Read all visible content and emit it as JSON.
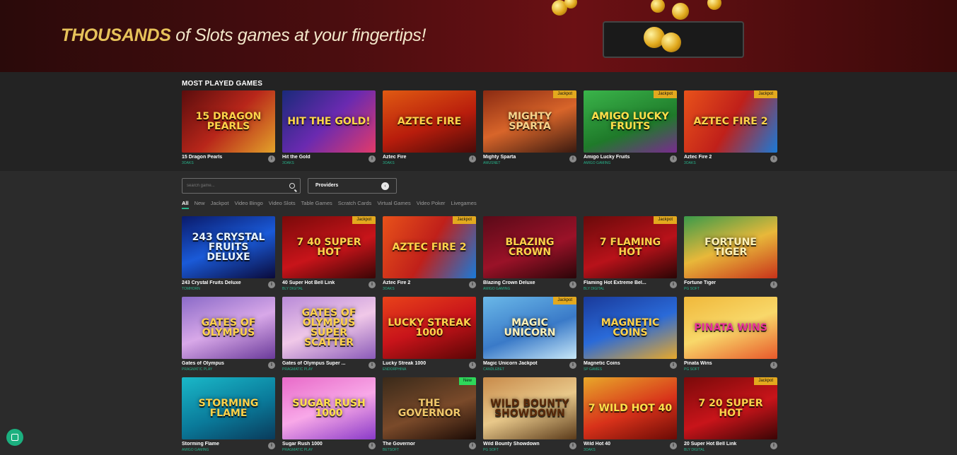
{
  "banner": {
    "highlight": "THOUSANDS",
    "text": " of Slots games at your fingertips!"
  },
  "most_played": {
    "title": "MOST PLAYED GAMES",
    "games": [
      {
        "name": "15 Dragon Pearls",
        "provider": "3OAKS",
        "art": "15 DRAGON PEARLS",
        "bg": "linear-gradient(135deg,#5a0d0d,#b8261a 50%,#e3a32a)",
        "color": "#ffd24a",
        "badge": ""
      },
      {
        "name": "Hit the Gold",
        "provider": "3OAKS",
        "art": "HIT THE GOLD!",
        "bg": "linear-gradient(135deg,#1a2a7a,#6a2ab0 50%,#e23a6a)",
        "color": "#ffd84a",
        "badge": ""
      },
      {
        "name": "Aztec Fire",
        "provider": "3OAKS",
        "art": "AZTEC FIRE",
        "bg": "linear-gradient(160deg,#e05a12,#b81d0c 55%,#4a0a08)",
        "color": "#ffd24a",
        "badge": ""
      },
      {
        "name": "Mighty Sparta",
        "provider": "AMUSNET",
        "art": "MIGHTY SPARTA",
        "bg": "linear-gradient(160deg,#8a2a12,#d8652a 50%,#3a1a10)",
        "color": "#f6d28a",
        "badge": "Jackpot"
      },
      {
        "name": "Amigo Lucky Fruits",
        "provider": "AMIGO GAMING",
        "art": "AMIGO LUCKY FRUITS",
        "bg": "linear-gradient(160deg,#3ab44a,#1f7a2a 60%,#7a2a90)",
        "color": "#ffe04a",
        "badge": "Jackpot"
      },
      {
        "name": "Aztec Fire 2",
        "provider": "3OAKS",
        "art": "AZTEC FIRE 2",
        "bg": "linear-gradient(120deg,#e8521a,#c0201a 50%,#1a7ad8)",
        "color": "#ffd24a",
        "badge": "Jackpot"
      }
    ]
  },
  "search": {
    "placeholder": "search game..."
  },
  "providers": {
    "label": "Providers",
    "toggle": "‹"
  },
  "tabs": [
    "All",
    "New",
    "Jackpot",
    "Video Bingo",
    "Video Slots",
    "Table Games",
    "Scratch Cards",
    "Virtual Games",
    "Video Poker",
    "Livegames"
  ],
  "games": [
    {
      "name": "243 Crystal Fruits Deluxe",
      "provider": "TOMHORN",
      "art": "243 CRYSTAL FRUITS DELUXE",
      "bg": "linear-gradient(160deg,#0a1a6a,#1a5ad8 50%,#0a0a3a)",
      "color": "#e8f4ff",
      "badge": ""
    },
    {
      "name": "40 Super Hot Bell Link",
      "provider": "BLY DIGITAL",
      "art": "7 40 SUPER HOT",
      "bg": "linear-gradient(160deg,#7a0a0a,#c8141a 55%,#3a0505)",
      "color": "#ffd24a",
      "badge": "Jackpot"
    },
    {
      "name": "Aztec Fire 2",
      "provider": "3OAKS",
      "art": "AZTEC FIRE 2",
      "bg": "linear-gradient(120deg,#e8521a,#c0201a 50%,#1a7ad8)",
      "color": "#ffd24a",
      "badge": "Jackpot"
    },
    {
      "name": "Blazing Crown Deluxe",
      "provider": "AMIGO GAMING",
      "art": "BLAZING CROWN",
      "bg": "linear-gradient(160deg,#5a0a18,#9a1228 55%,#2a0508)",
      "color": "#ffd24a",
      "badge": ""
    },
    {
      "name": "Flaming Hot Extreme Bel...",
      "provider": "BLY DIGITAL",
      "art": "7 FLAMING HOT",
      "bg": "linear-gradient(160deg,#6a0a0a,#b8121a 55%,#2a0505)",
      "color": "#ffd24a",
      "badge": "Jackpot"
    },
    {
      "name": "Fortune Tiger",
      "provider": "PG SOFT",
      "art": "FORTUNE TIGER",
      "bg": "linear-gradient(160deg,#3a9a4a,#e8b83a 50%,#c8321a)",
      "color": "#fff2b8",
      "badge": ""
    },
    {
      "name": "Gates of Olympus",
      "provider": "PRAGMATIC PLAY",
      "art": "GATES OF OLYMPUS",
      "bg": "linear-gradient(160deg,#8a6ac8,#d8a8e8 50%,#6a3a9a)",
      "color": "#ffd24a",
      "badge": ""
    },
    {
      "name": "Gates of Olympus Super ...",
      "provider": "PRAGMATIC PLAY",
      "art": "GATES OF OLYMPUS SUPER SCATTER",
      "bg": "linear-gradient(160deg,#b88ad8,#f0c8e8 50%,#8a5ab8)",
      "color": "#ffd24a",
      "badge": ""
    },
    {
      "name": "Lucky Streak 1000",
      "provider": "ENDORPHINA",
      "art": "LUCKY STREAK 1000",
      "bg": "linear-gradient(160deg,#e8421a,#c8141a 50%,#5a0505)",
      "color": "#ffd24a",
      "badge": ""
    },
    {
      "name": "Magic Unicorn Jackpot",
      "provider": "CANDLEBET",
      "art": "MAGIC UNICORN",
      "bg": "linear-gradient(160deg,#6ab8e8,#3a7ac8 55%,#c8e8f8)",
      "color": "#fff2b8",
      "badge": "Jackpot"
    },
    {
      "name": "Magnetic Coins",
      "provider": "SP GAMES",
      "art": "MAGNETIC COINS",
      "bg": "linear-gradient(160deg,#1a3a9a,#2a6ad8 50%,#e8a82a)",
      "color": "#ffd24a",
      "badge": ""
    },
    {
      "name": "Pinata Wins",
      "provider": "PG SOFT",
      "art": "PINATA WINS",
      "bg": "linear-gradient(160deg,#f0b83a,#f8d86a 50%,#e8582a)",
      "color": "#e8329a",
      "badge": ""
    },
    {
      "name": "Storming Flame",
      "provider": "AMIGO GAMING",
      "art": "STORMING FLAME",
      "bg": "linear-gradient(160deg,#1ab8c8,#0a7a9a 55%,#0a3a5a)",
      "color": "#ffd24a",
      "badge": ""
    },
    {
      "name": "Sugar Rush 1000",
      "provider": "PRAGMATIC PLAY",
      "art": "SUGAR RUSH 1000",
      "bg": "linear-gradient(160deg,#e86ac8,#f8a8e8 50%,#8a3ac8)",
      "color": "#ffe04a",
      "badge": ""
    },
    {
      "name": "The Governor",
      "provider": "BETSOFT",
      "art": "THE GOVERNOR",
      "bg": "linear-gradient(160deg,#3a2a1a,#7a4a2a 55%,#1a0a05)",
      "color": "#f0c86a",
      "badge": "New"
    },
    {
      "name": "Wild Bounty Showdown",
      "provider": "PG SOFT",
      "art": "WILD BOUNTY SHOWDOWN",
      "bg": "linear-gradient(160deg,#c88a4a,#e8c88a 50%,#5a3a1a)",
      "color": "#5a2a0a",
      "badge": ""
    },
    {
      "name": "Wild Hot 40",
      "provider": "3OAKS",
      "art": "7 WILD HOT 40",
      "bg": "linear-gradient(160deg,#e8a82a,#d8321a 55%,#6a0a05)",
      "color": "#ffe04a",
      "badge": ""
    },
    {
      "name": "20 Super Hot Bell Link",
      "provider": "BLY DIGITAL",
      "art": "7 20 SUPER HOT",
      "bg": "linear-gradient(160deg,#7a0a0a,#c8141a 55%,#3a0505)",
      "color": "#ffd24a",
      "badge": "Jackpot"
    }
  ],
  "colors": {
    "accent": "#27b28a",
    "jackpot": "#e3a91e",
    "new": "#2ed85a",
    "background": "#2b2b2b"
  },
  "icons": {
    "search": "search-icon",
    "info": "info-icon",
    "chat": "chat-icon"
  }
}
